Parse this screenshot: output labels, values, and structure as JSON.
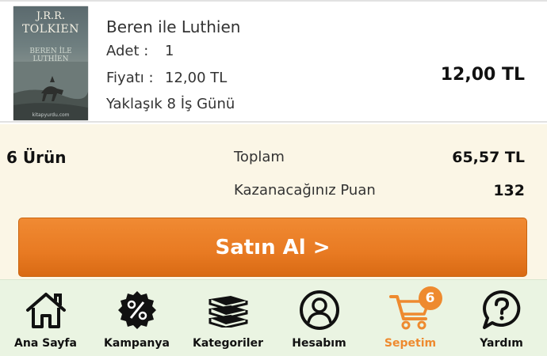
{
  "cart_item": {
    "cover": {
      "author_line1": "J.R.R.",
      "author_line2": "TOLKIEN",
      "title": "BEREN İLE LUTHİEN",
      "footer": "kitapyurdu.com"
    },
    "name": "Beren ile Luthien",
    "qty_label": "Adet :",
    "qty_value": "1",
    "price_label": "Fiyatı :",
    "price_value": "12,00 TL",
    "delivery": "Yaklaşık 8 İş Günü",
    "total": "12,00 TL"
  },
  "summary": {
    "item_count": "6 Ürün",
    "total_label": "Toplam",
    "total_value": "65,57 TL",
    "points_label": "Kazanacağınız Puan",
    "points_value": "132"
  },
  "buy_button": {
    "label": "Satın Al >"
  },
  "nav": {
    "items": [
      {
        "label": "Ana Sayfa",
        "icon": "home-icon"
      },
      {
        "label": "Kampanya",
        "icon": "percent-badge-icon"
      },
      {
        "label": "Kategoriler",
        "icon": "books-stack-icon"
      },
      {
        "label": "Hesabım",
        "icon": "user-icon"
      },
      {
        "label": "Sepetim",
        "icon": "cart-icon",
        "badge": "6",
        "active": true
      },
      {
        "label": "Yardım",
        "icon": "help-icon"
      }
    ]
  },
  "colors": {
    "accent": "#ee8a2f",
    "button": "#e87a22",
    "summary_bg": "#fbf6e6",
    "nav_bg": "#eaf4e2"
  }
}
